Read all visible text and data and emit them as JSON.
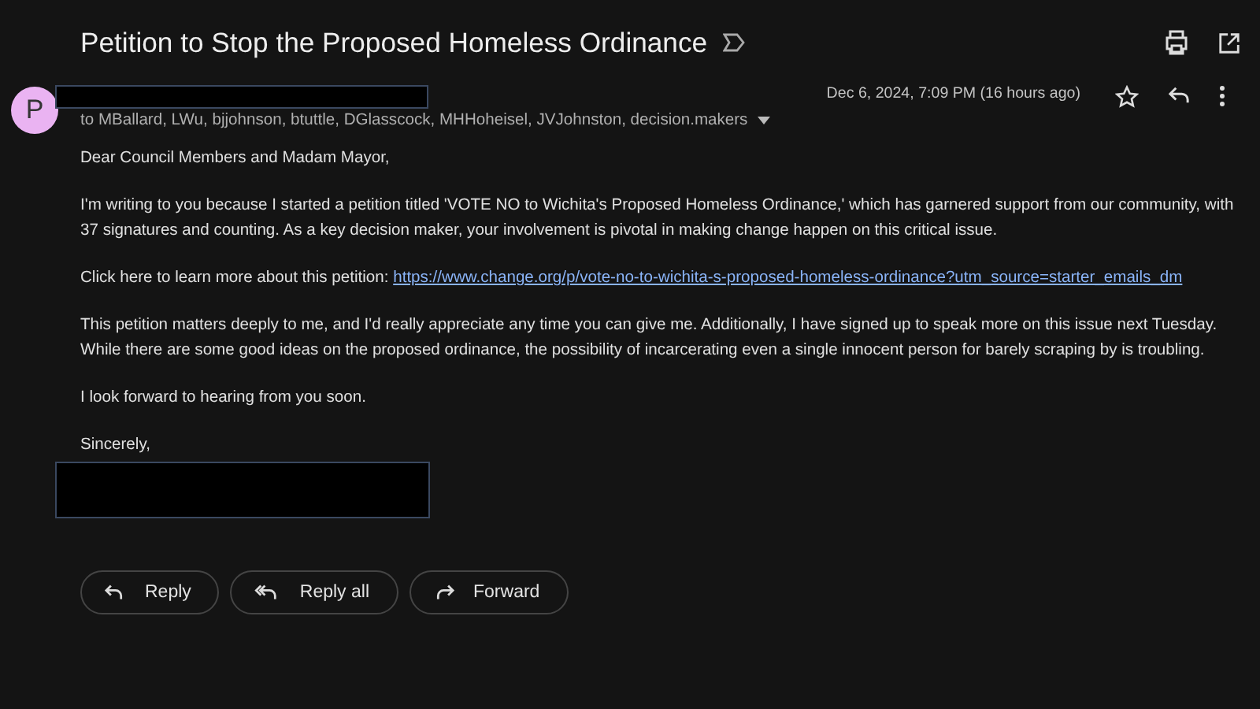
{
  "subject": {
    "title": "Petition to Stop the Proposed Homeless Ordinance"
  },
  "sender": {
    "avatar_letter": "P",
    "recipients": "to MBallard, LWu, bjjohnson, btuttle, DGlasscock, MHHoheisel, JVJohnston, decision.makers",
    "date": "Dec 6, 2024, 7:09 PM (16 hours ago)"
  },
  "body": [
    {
      "kind": "text",
      "text": "Dear Council Members and Madam Mayor,"
    },
    {
      "kind": "text",
      "text": "I'm writing to you because I started a petition titled 'VOTE NO to Wichita's Proposed Homeless Ordinance,' which has garnered support from our community, with 37 signatures and counting. As a key decision maker, your involvement is pivotal in making change happen on this critical issue."
    },
    {
      "kind": "link",
      "text": "Click here to learn more about this petition: ",
      "link": "https://www.change.org/p/vote-no-to-wichita-s-proposed-homeless-ordinance?utm_source=starter_emails_dm"
    },
    {
      "kind": "text",
      "text": "This petition matters deeply to me, and I'd really appreciate any time you can give me. Additionally, I have signed up to speak more on this issue next Tuesday. While there are some good ideas on the proposed ordinance, the possibility of incarcerating even a single innocent person for barely scraping by is troubling."
    },
    {
      "kind": "text",
      "text": "I look forward to hearing from you soon."
    },
    {
      "kind": "text",
      "text": "Sincerely,"
    }
  ],
  "actions": [
    {
      "kind": "reply",
      "label": "Reply"
    },
    {
      "kind": "reply_all",
      "label": "Reply all"
    },
    {
      "kind": "forward",
      "label": "Forward"
    }
  ]
}
